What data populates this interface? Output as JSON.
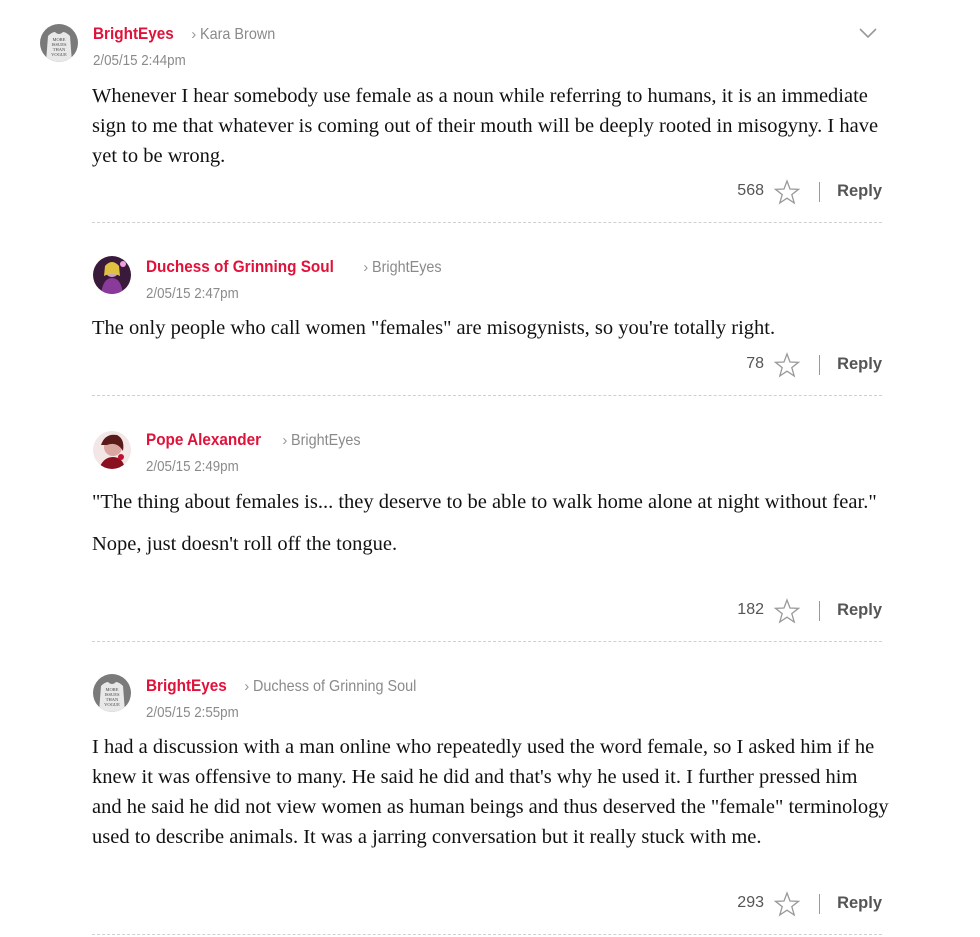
{
  "comments": [
    {
      "author": "BrightEyes",
      "reply_to": "Kara Brown",
      "timestamp": "2/05/15 2:44pm",
      "body": [
        "Whenever I hear somebody use female as a noun while referring to humans, it is an immediate sign to me that whatever is coming out of their mouth will be deeply rooted in misogyny. I have yet to be wrong."
      ],
      "stars": "568",
      "reply_label": "Reply",
      "avatar_icon": "shirt-text-avatar-icon"
    },
    {
      "author": "Duchess of Grinning Soul",
      "reply_to": "BrightEyes",
      "timestamp": "2/05/15 2:47pm",
      "body": [
        "The only people who call women \"females\" are misogynists, so you're totally right."
      ],
      "stars": "78",
      "reply_label": "Reply",
      "avatar_icon": "purple-figure-avatar-icon"
    },
    {
      "author": "Pope Alexander",
      "reply_to": "BrightEyes",
      "timestamp": "2/05/15 2:49pm",
      "body": [
        "\"The thing about females is... they deserve to be able to walk home alone at night without fear.\"",
        "Nope, just doesn't roll off the tongue."
      ],
      "stars": "182",
      "reply_label": "Reply",
      "avatar_icon": "portrait-avatar-icon"
    },
    {
      "author": "BrightEyes",
      "reply_to": "Duchess of Grinning Soul",
      "timestamp": "2/05/15 2:55pm",
      "body": [
        "I had a discussion with a man online who repeatedly used the word female, so I asked him if he knew it was offensive to many. He said he did and that's why he used it. I further pressed him and he said he did not view women as human beings and thus deserved the \"female\" terminology used to describe animals. It was a jarring conversation but it really stuck with me."
      ],
      "stars": "293",
      "reply_label": "Reply",
      "avatar_icon": "shirt-text-avatar-icon"
    }
  ],
  "avatar_shirt_text": [
    "MORE",
    "ISSUES",
    "THAN",
    "VOGUE"
  ],
  "icons": {
    "expand": "chevron-down-icon",
    "star": "star-outline-icon",
    "reply_chevron": "chevron-right-icon"
  },
  "colors": {
    "author": "#e0123a",
    "meta": "#8a8a8a",
    "body": "#111111",
    "divider": "#d0d0d0"
  }
}
